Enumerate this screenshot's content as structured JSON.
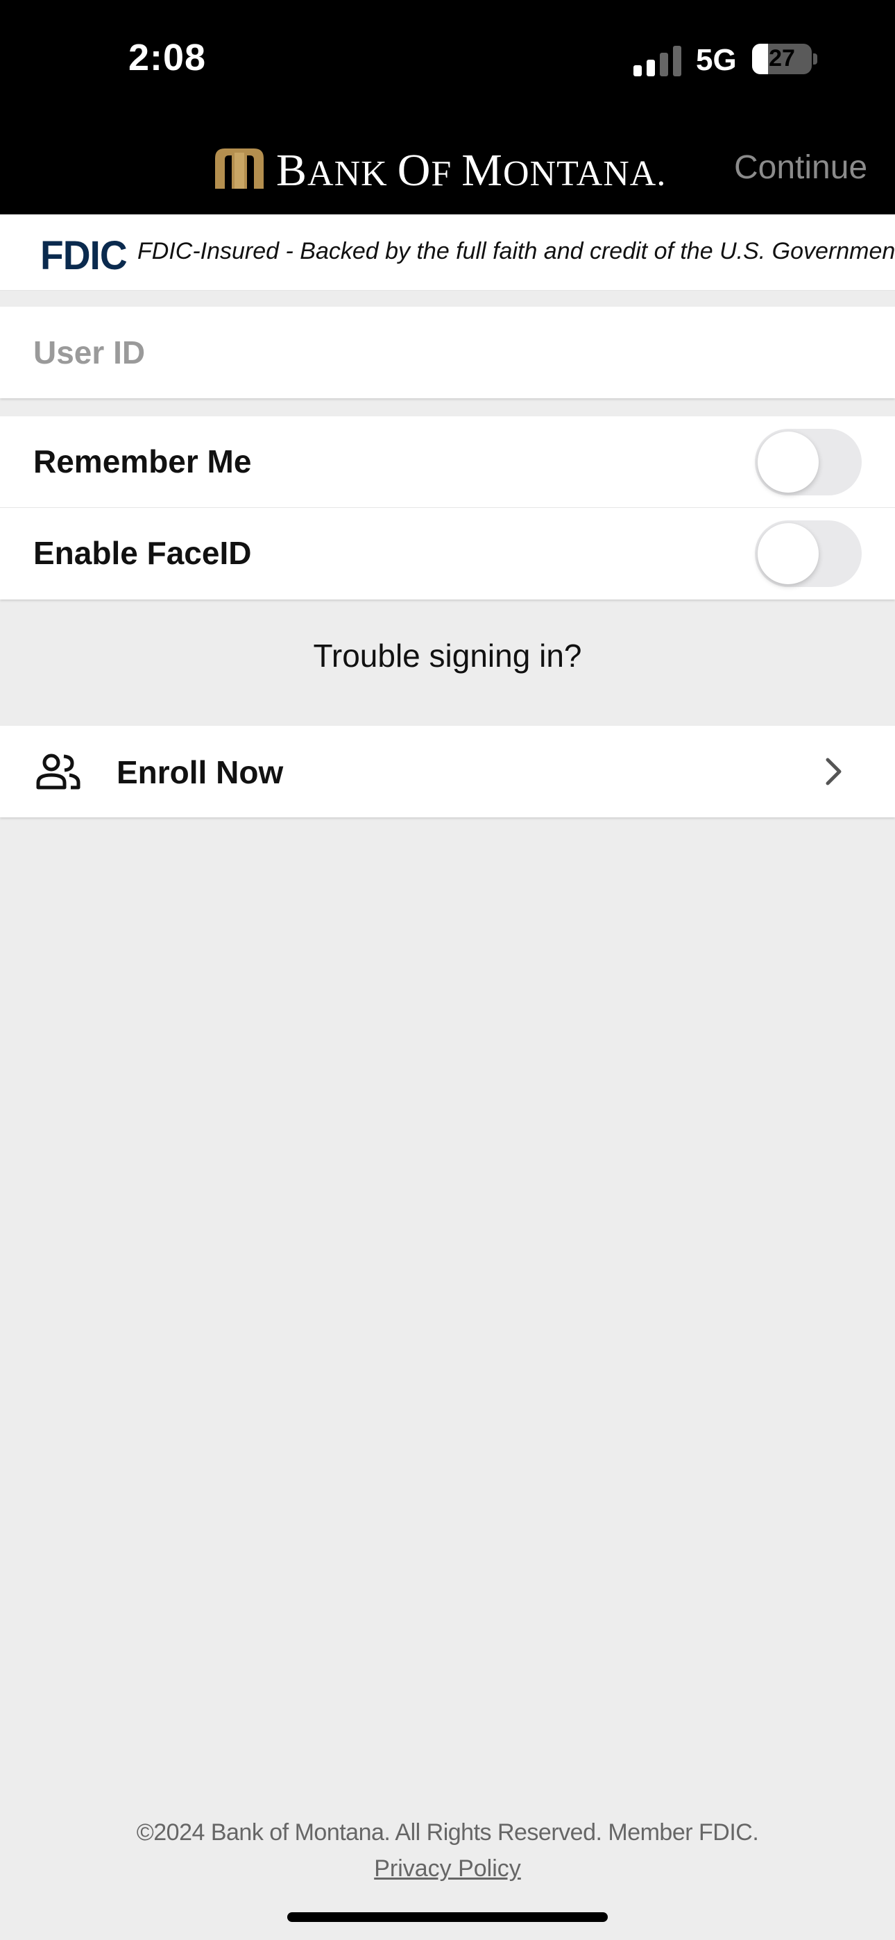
{
  "status_bar": {
    "time": "2:08",
    "network": "5G",
    "battery": "27",
    "battery_level": 0.27
  },
  "header": {
    "brand_main": "Bank of Montana",
    "continue_label": "Continue",
    "accent_color": "#b48f4f"
  },
  "fdic": {
    "logo": "FDIC",
    "text": "FDIC-Insured - Backed by the full faith and credit of the U.S. Government"
  },
  "login": {
    "user_id_placeholder": "User ID",
    "user_id_value": ""
  },
  "toggles": [
    {
      "label": "Remember Me",
      "on": false
    },
    {
      "label": "Enable FaceID",
      "on": false
    }
  ],
  "trouble_link": "Trouble signing in?",
  "enroll": {
    "label": "Enroll Now",
    "icon": "people-icon"
  },
  "footer": {
    "copyright": "©2024 Bank of Montana. All Rights Reserved. Member FDIC.",
    "privacy_link": "Privacy Policy"
  }
}
